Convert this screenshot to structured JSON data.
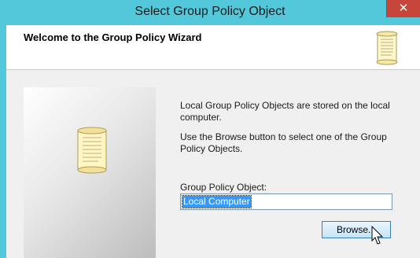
{
  "window": {
    "title": "Select Group Policy Object",
    "close_label": "✕"
  },
  "header": {
    "title": "Welcome to the Group Policy Wizard"
  },
  "body": {
    "description_1": "Local Group Policy Objects are stored on the local computer.",
    "description_2": "Use the Browse button to select one of the Group Policy Objects.",
    "gpo_label": "Group Policy Object:",
    "gpo_value": "Local Computer",
    "browse_label": "Browse..."
  },
  "icons": {
    "header_icon": "scroll-icon",
    "side_icon": "scroll-icon",
    "cursor": "mouse-pointer-icon"
  },
  "colors": {
    "titlebar": "#52c8da",
    "close": "#c7453a",
    "selection": "#3399ff"
  }
}
